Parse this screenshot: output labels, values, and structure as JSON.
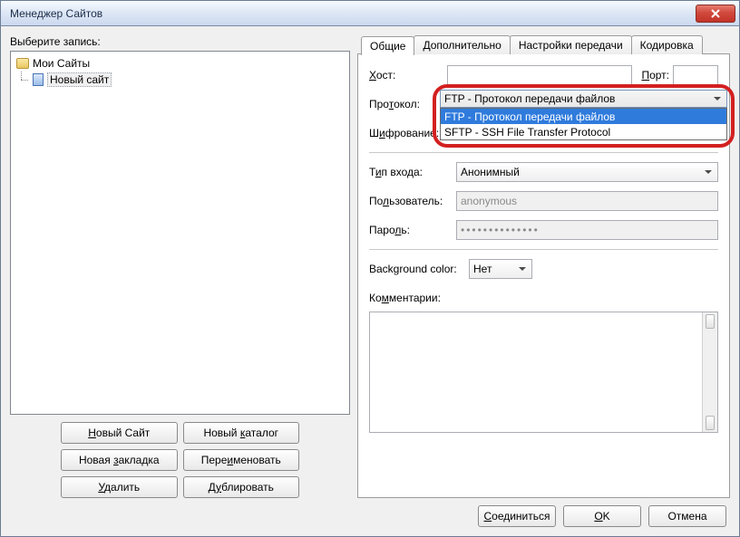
{
  "window_title": "Менеджер Сайтов",
  "left": {
    "select_label": "Выберите запись:",
    "root": "Мои Сайты",
    "child": "Новый сайт",
    "buttons": {
      "new_site_pre": "Н",
      "new_site_rest": "овый Сайт",
      "new_folder_pre": "Новый ",
      "new_folder_u": "к",
      "new_folder_rest": "аталог",
      "bookmark_pre": "Новая ",
      "bookmark_u": "з",
      "bookmark_rest": "акладка",
      "rename_pre": "Пере",
      "rename_u": "и",
      "rename_rest": "меновать",
      "delete_pre": "",
      "delete_u": "У",
      "delete_rest": "далить",
      "dup_pre": "Д",
      "dup_u": "у",
      "dup_rest": "блировать"
    }
  },
  "tabs": {
    "general": "Общие",
    "advanced": "Дополнительно",
    "transfer": "Настройки передачи",
    "charset": "Кодировка"
  },
  "form": {
    "host_label_u": "Х",
    "host_label_rest": "ост:",
    "port_label_u": "П",
    "port_label_rest": "орт:",
    "protocol_label_pre": "Про",
    "protocol_label_u": "т",
    "protocol_label_rest": "окол:",
    "encryption_label_pre": "Ш",
    "encryption_label_u": "и",
    "encryption_label_rest": "фрование:",
    "logon_label_pre": "Т",
    "logon_label_u": "и",
    "logon_label_rest": "п входа:",
    "user_label_pre": "По",
    "user_label_u": "л",
    "user_label_rest": "ьзователь:",
    "pass_label_pre": "Паро",
    "pass_label_u": "л",
    "pass_label_rest": "ь:",
    "logon_value": "Анонимный",
    "user_value": "anonymous",
    "pass_value": "••••••••••••••",
    "bgcolor_label": "Background color:",
    "bgcolor_value": "Нет",
    "comments_label": "Ко",
    "comments_u": "м",
    "comments_rest": "ментарии:"
  },
  "dropdown": {
    "selected": "FTP - Протокол передачи файлов",
    "opt1": "FTP - Протокол передачи файлов",
    "opt2": "SFTP - SSH File Transfer Protocol"
  },
  "footer": {
    "connect_u": "С",
    "connect_rest": "оединиться",
    "ok_u": "O",
    "ok_rest": "K",
    "cancel": "Отмена"
  }
}
